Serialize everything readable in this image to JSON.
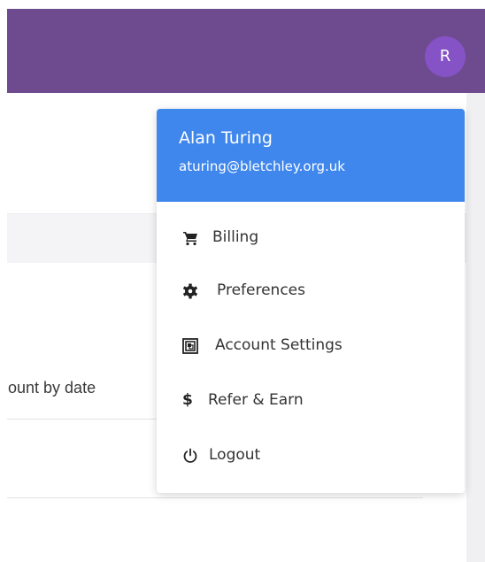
{
  "header": {
    "avatar_initial": "R",
    "bar_color": "#6e4a8e",
    "avatar_color": "#8553c6"
  },
  "background": {
    "partial_text": "ount by date"
  },
  "dropdown": {
    "header_color": "#3f87ec",
    "user_name": "Alan Turing",
    "user_email": "aturing@bletchley.org.uk",
    "items": [
      {
        "label": "Billing",
        "icon": "cart-icon"
      },
      {
        "label": "Preferences",
        "icon": "gear-icon"
      },
      {
        "label": "Account Settings",
        "icon": "account-settings-icon"
      },
      {
        "label": "Refer & Earn",
        "icon": "dollar-icon"
      },
      {
        "label": "Logout",
        "icon": "power-icon"
      }
    ]
  }
}
